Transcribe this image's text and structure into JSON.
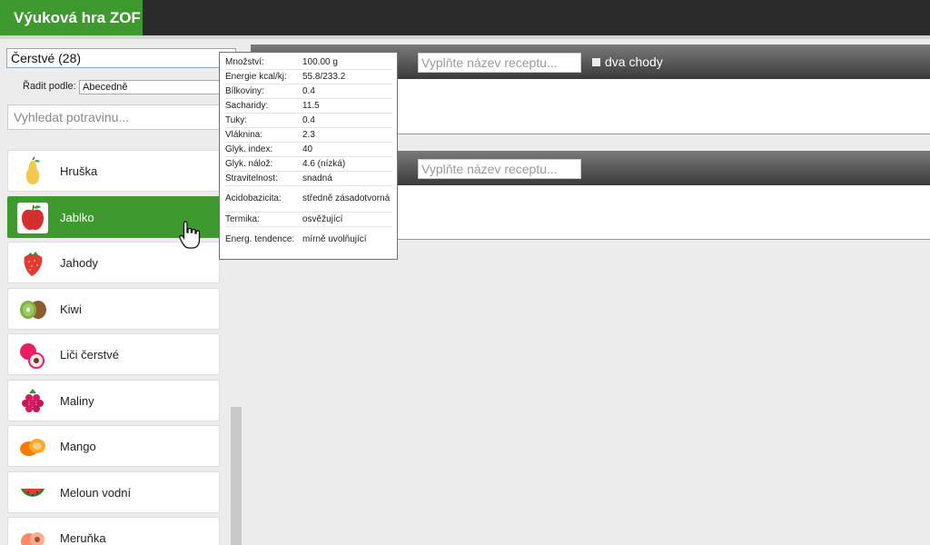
{
  "app": {
    "title": "Výuková hra ZOF"
  },
  "filters": {
    "category": "Čerstvé (28)",
    "sort_label": "Řadit podle:",
    "sort_value": "Abecedně",
    "search_placeholder": "Vyhledat potravinu..."
  },
  "foods": [
    {
      "name": "Hruška",
      "icon": "pear-icon",
      "active": false
    },
    {
      "name": "Jablko",
      "icon": "apple-icon",
      "active": true
    },
    {
      "name": "Jahody",
      "icon": "strawberry-icon",
      "active": false
    },
    {
      "name": "Kiwi",
      "icon": "kiwi-icon",
      "active": false
    },
    {
      "name": "Liči čerstvé",
      "icon": "lychee-icon",
      "active": false
    },
    {
      "name": "Maliny",
      "icon": "raspberry-icon",
      "active": false
    },
    {
      "name": "Mango",
      "icon": "mango-icon",
      "active": false
    },
    {
      "name": "Meloun vodní",
      "icon": "watermelon-icon",
      "active": false
    },
    {
      "name": "Meruňka",
      "icon": "apricot-icon",
      "active": false
    }
  ],
  "recipes": {
    "name_placeholder": "Vyplňte název receptu...",
    "two_courses_label": "dva chody"
  },
  "nutrition": [
    {
      "label": "Množství:",
      "value": "100.00 g"
    },
    {
      "label": "Energie kcal/kj:",
      "value": "55.8/233.2"
    },
    {
      "label": "Bílkoviny:",
      "value": "0.4"
    },
    {
      "label": "Sacharidy:",
      "value": "11.5"
    },
    {
      "label": "Tuky:",
      "value": "0.4"
    },
    {
      "label": "Vláknina:",
      "value": "2.3"
    },
    {
      "label": "Glyk. index:",
      "value": "40"
    },
    {
      "label": "Glyk. nálož:",
      "value": "4.6 (nízká)"
    },
    {
      "label": "Stravitelnost:",
      "value": "snadná"
    },
    {
      "label": "Acidobazicita:",
      "value": "středně zásadotvorná"
    },
    {
      "label": "Termika:",
      "value": "osvěžující"
    },
    {
      "label": "Energ. tendence:",
      "value": "mírně uvolňující"
    }
  ],
  "colors": {
    "accent": "#3e9a2e",
    "topbar": "#2b2b2b"
  }
}
